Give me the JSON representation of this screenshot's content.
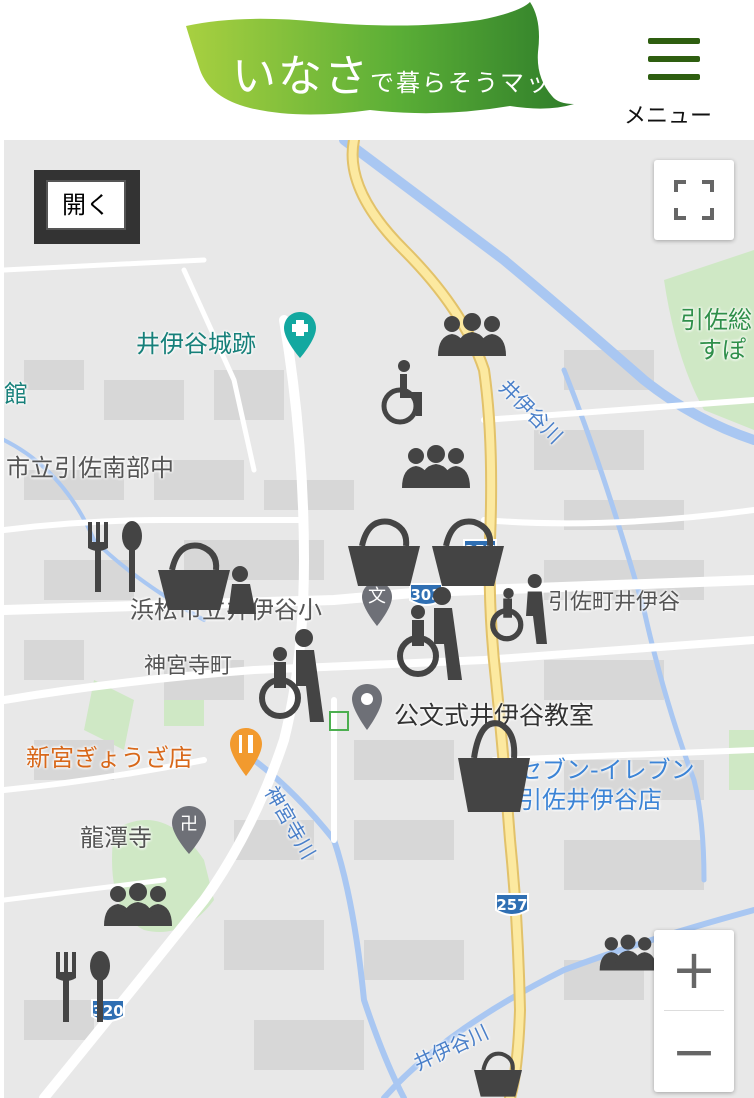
{
  "header": {
    "logo_text": "いなさ",
    "logo_small": "で",
    "logo_text2": "暮らそうマップ",
    "menu_label": "メニュー",
    "logo_color_dark": "#3e8e2e",
    "logo_color_light": "#a6cf3c"
  },
  "map": {
    "open_button": "開く",
    "zoom_in": "+",
    "zoom_out": "−",
    "labels": {
      "castle": "井伊谷城跡",
      "kan": "館",
      "school_middle": "市立引佐南部中",
      "school_elem": "浜松市立井伊谷小",
      "bun": "文",
      "jinguji": "神宮寺町",
      "kumon": "公文式井伊谷教室",
      "shinmiya": "新宮ぎょうざ店",
      "ryutanji": "龍潭寺",
      "seven1": "セブン-イレブン",
      "seven2": "引佐井伊谷店",
      "hikisa_iinoya": "引佐町井伊谷",
      "hikisa_sou": "引佐総",
      "hikisa_sou2": "すぽ",
      "river_iinoya1": "井伊谷川",
      "river_iinoya2": "井伊谷川",
      "river_jinguji": "神宮寺川"
    },
    "route_shields": [
      "257",
      "303",
      "257",
      "320"
    ],
    "markers": [
      "group-icon",
      "wheelchair-icon",
      "group-icon",
      "shopping-basket-icon",
      "shopping-basket-icon",
      "restaurant-icon",
      "shopping-basket-icon",
      "caregiver-wheelchair-icon",
      "caregiver-wheelchair-icon",
      "caregiver-wheelchair-icon",
      "shopping-basket-icon",
      "group-icon",
      "restaurant-icon",
      "group-icon",
      "shopping-basket-icon"
    ]
  }
}
